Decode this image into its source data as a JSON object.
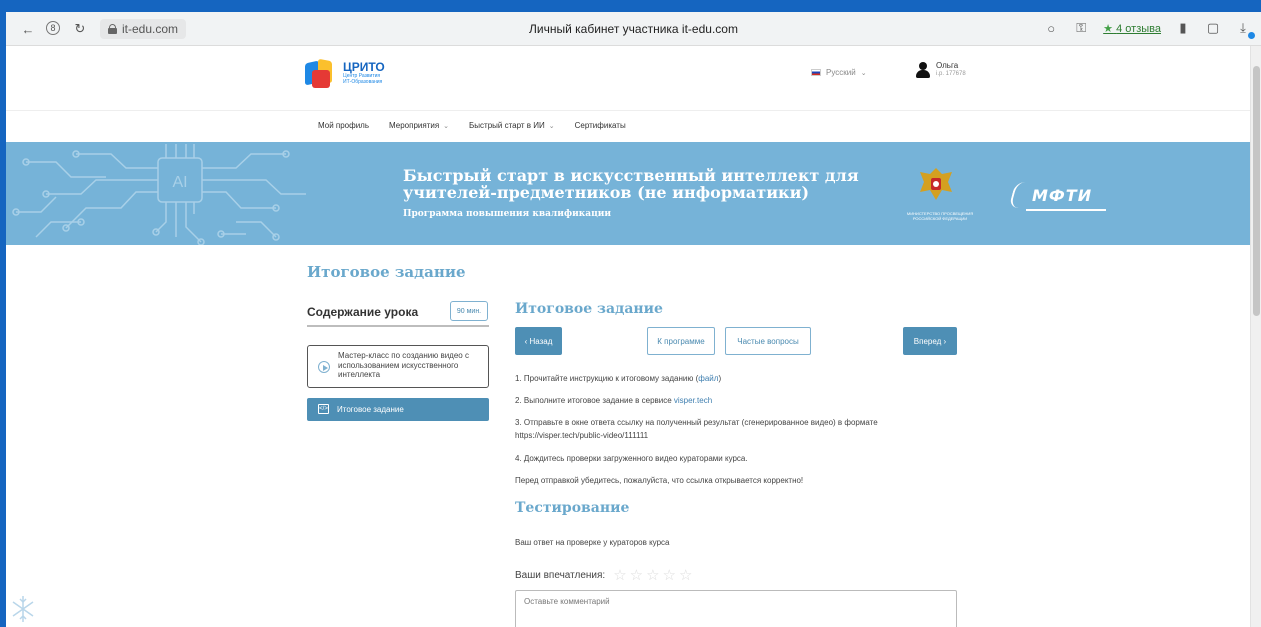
{
  "browser": {
    "url": "it-edu.com",
    "tab_title": "Личный кабинет участника it-edu.com",
    "reviews_label": "4 отзыва",
    "rank_icon": "8"
  },
  "header": {
    "logo_name": "ЦРИТО",
    "logo_sub_1": "Центр Развития",
    "logo_sub_2": "ИТ-Образования",
    "language": "Русский",
    "user_name": "Ольга",
    "user_id": "i.p. 177678"
  },
  "nav": {
    "items": [
      {
        "label": "Мой профиль",
        "has_dropdown": false
      },
      {
        "label": "Мероприятия",
        "has_dropdown": true
      },
      {
        "label": "Быстрый старт в ИИ",
        "has_dropdown": true
      },
      {
        "label": "Сертификаты",
        "has_dropdown": false
      }
    ]
  },
  "banner": {
    "ai_label": "AI",
    "title": "Быстрый старт в искусственный интеллект для учителей-предметников (не информатики)",
    "subtitle": "Программа повышения квалификации",
    "emblem_caption": "Министерство просвещения Российской Федерации",
    "mfti": "МФТИ"
  },
  "lesson": {
    "heading": "Итоговое задание",
    "toc_title": "Содержание урока",
    "duration": "90 мин.",
    "items": [
      {
        "label": "Мастер-класс по созданию видео с использованием искусственного интеллекта",
        "active": false
      },
      {
        "label": "Итоговое задание",
        "active": true
      }
    ]
  },
  "task": {
    "title": "Итоговое задание",
    "back_label": "‹ Назад",
    "program_label": "К программе",
    "faq_label": "Частые вопросы",
    "next_label": "Вперед ›",
    "step1_text": "1. Прочитайте инструкцию к итоговому заданию (",
    "step1_link": "файл",
    "step1_end": ")",
    "step2_text": "2. Выполните итоговое задание в сервисе ",
    "step2_link": "visper.tech",
    "step3_text": "3. Отправьте в окне ответа ссылку на полученный результат (сгенерированное видео) в формате https://visper.tech/public-video/111111",
    "step4_text": "4. Дождитесь проверки загруженного видео кураторами курса.",
    "note": "Перед отправкой убедитесь, пожалуйста, что ссылка открывается корректно!"
  },
  "testing": {
    "title": "Тестирование",
    "status": "Ваш ответ на проверке у кураторов курса",
    "impressions_label": "Ваши впечатления:",
    "rating": 0,
    "rating_max": 5,
    "comment_placeholder": "Оставьте комментарий"
  },
  "colors": {
    "accent": "#4e8fb5",
    "heading": "#6aa8cc",
    "banner": "#76b3d8",
    "frame": "#1565c0"
  }
}
